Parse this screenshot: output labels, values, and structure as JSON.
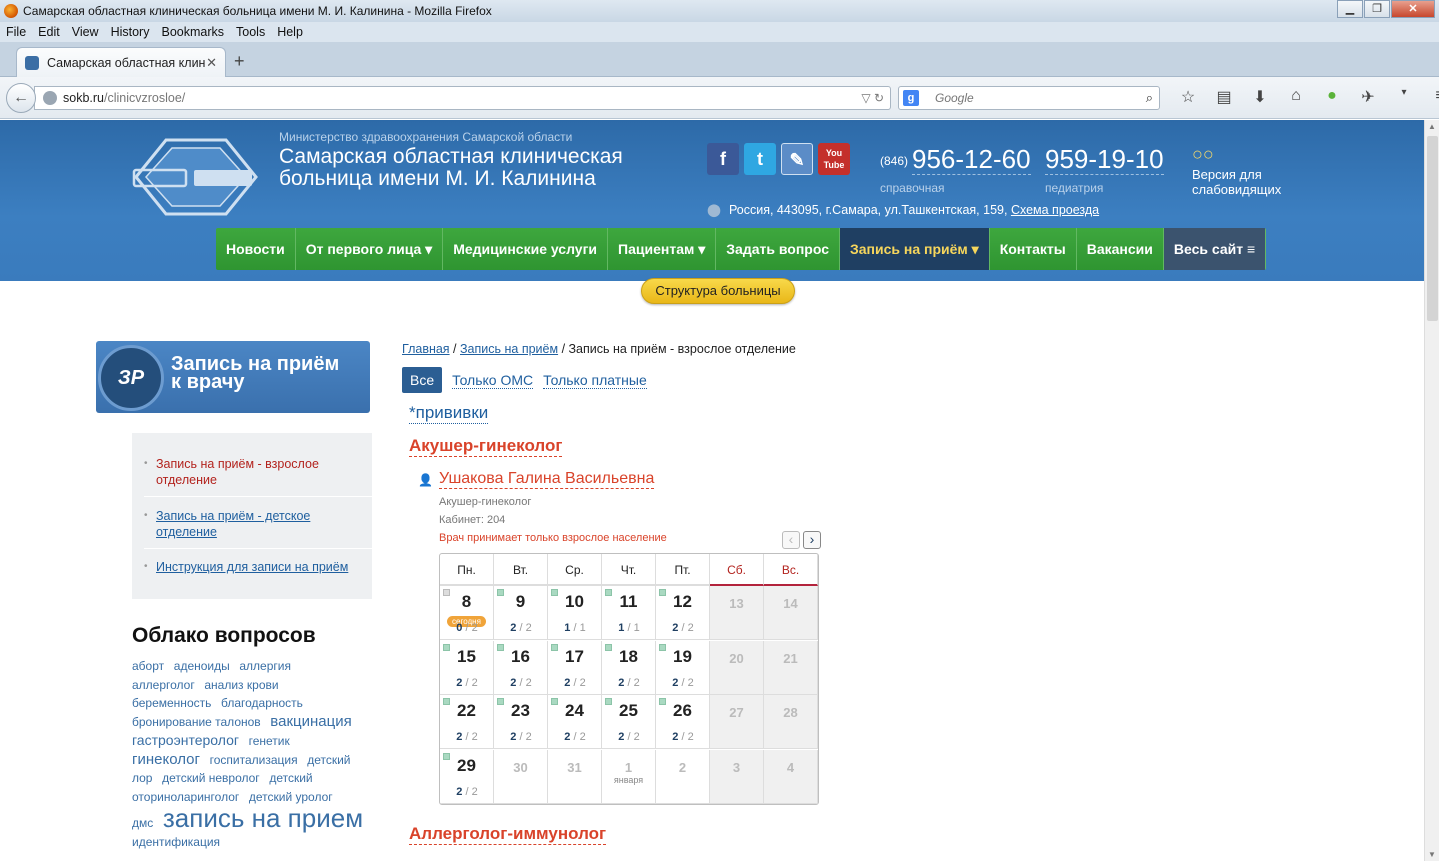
{
  "window": {
    "title": "Самарская областная клиническая больница имени М. И. Калинина - Mozilla Firefox"
  },
  "menubar": [
    "File",
    "Edit",
    "View",
    "History",
    "Bookmarks",
    "Tools",
    "Help"
  ],
  "tab": {
    "title": "Самарская областная клини..."
  },
  "url": {
    "host": "sokb.ru",
    "path": "/clinicvzrosloe/"
  },
  "search": {
    "placeholder": "Google"
  },
  "header": {
    "ministry": "Министерство здравоохранения Самарской области",
    "hospital": "Самарская областная клиническая больница имени М. И. Калинина",
    "phone1": {
      "code": "(846)",
      "number": "956-12-60",
      "label": "справочная"
    },
    "phone2": {
      "number": "959-19-10",
      "label": "педиатрия"
    },
    "visually_impaired": "Версия для слабовидящих",
    "address": "Россия, 443095, г.Самара, ул.Ташкентская, 159,",
    "map_link": "Схема проезда",
    "social": [
      "facebook-icon",
      "twitter-icon",
      "vk-icon",
      "youtube-icon"
    ]
  },
  "nav": [
    {
      "label": "Новости"
    },
    {
      "label": "От первого лица ▾"
    },
    {
      "label": "Медицинские услуги"
    },
    {
      "label": "Пациентам ▾"
    },
    {
      "label": "Задать вопрос"
    },
    {
      "label": "Запись на приём ▾",
      "active": true
    },
    {
      "label": "Контакты"
    },
    {
      "label": "Вакансии"
    },
    {
      "label": "Весь сайт ≡"
    }
  ],
  "structure_button": "Структура больницы",
  "banner": {
    "logo": "ЗР",
    "line1": "Запись на приём",
    "line2": "к врачу"
  },
  "sidemenu": [
    "Запись на приём - взрослое отделение",
    "Запись на приём - детское отделение",
    "Инструкция для записи на приём"
  ],
  "cloud": {
    "title": "Облако вопросов",
    "tags": [
      "аборт",
      "аденоиды",
      "аллергия",
      "аллерголог",
      "анализ крови",
      "беременность",
      "благодарность",
      "бронирование талонов",
      "вакцинация",
      "гастроэнтеролог",
      "генетик",
      "гинеколог",
      "госпитализация",
      "детский лор",
      "детский невролог",
      "детский оториноларинголог",
      "детский уролог",
      "дмс",
      "запись на прием",
      "идентификация"
    ]
  },
  "breadcrumb": {
    "home": "Главная",
    "section": "Запись на приём",
    "current": "/ Запись на приём - взрослое отделение"
  },
  "filters": {
    "all": "Все",
    "oms": "Только ОМС",
    "paid": "Только платные"
  },
  "vaccines": "*прививки",
  "specialty1": "Акушер-гинеколог",
  "doctor": {
    "name": "Ушакова Галина Васильевна",
    "role": "Акушер-гинеколог",
    "cabinet": "Кабинет: 204",
    "note": "Врач принимает только взрослое население"
  },
  "specialty2": "Аллерголог-иммунолог",
  "calendar": {
    "weekdays": [
      "Пн.",
      "Вт.",
      "Ср.",
      "Чт.",
      "Пт.",
      "Сб.",
      "Вс."
    ],
    "today_label": "сегодня",
    "month_label": "января",
    "weeks": [
      [
        {
          "d": "8",
          "f": "0",
          "t": "2",
          "today": true
        },
        {
          "d": "9",
          "f": "2",
          "t": "2"
        },
        {
          "d": "10",
          "f": "1",
          "t": "1"
        },
        {
          "d": "11",
          "f": "1",
          "t": "1"
        },
        {
          "d": "12",
          "f": "2",
          "t": "2"
        },
        {
          "d": "13"
        },
        {
          "d": "14"
        }
      ],
      [
        {
          "d": "15",
          "f": "2",
          "t": "2"
        },
        {
          "d": "16",
          "f": "2",
          "t": "2"
        },
        {
          "d": "17",
          "f": "2",
          "t": "2"
        },
        {
          "d": "18",
          "f": "2",
          "t": "2"
        },
        {
          "d": "19",
          "f": "2",
          "t": "2"
        },
        {
          "d": "20"
        },
        {
          "d": "21"
        }
      ],
      [
        {
          "d": "22",
          "f": "2",
          "t": "2"
        },
        {
          "d": "23",
          "f": "2",
          "t": "2"
        },
        {
          "d": "24",
          "f": "2",
          "t": "2"
        },
        {
          "d": "25",
          "f": "2",
          "t": "2"
        },
        {
          "d": "26",
          "f": "2",
          "t": "2"
        },
        {
          "d": "27"
        },
        {
          "d": "28"
        }
      ],
      [
        {
          "d": "29",
          "f": "2",
          "t": "2"
        },
        {
          "d": "30",
          "dim": true
        },
        {
          "d": "31",
          "dim": true
        },
        {
          "d": "1",
          "dim": true,
          "month": true
        },
        {
          "d": "2",
          "dim": true
        },
        {
          "d": "3"
        },
        {
          "d": "4"
        }
      ]
    ]
  }
}
